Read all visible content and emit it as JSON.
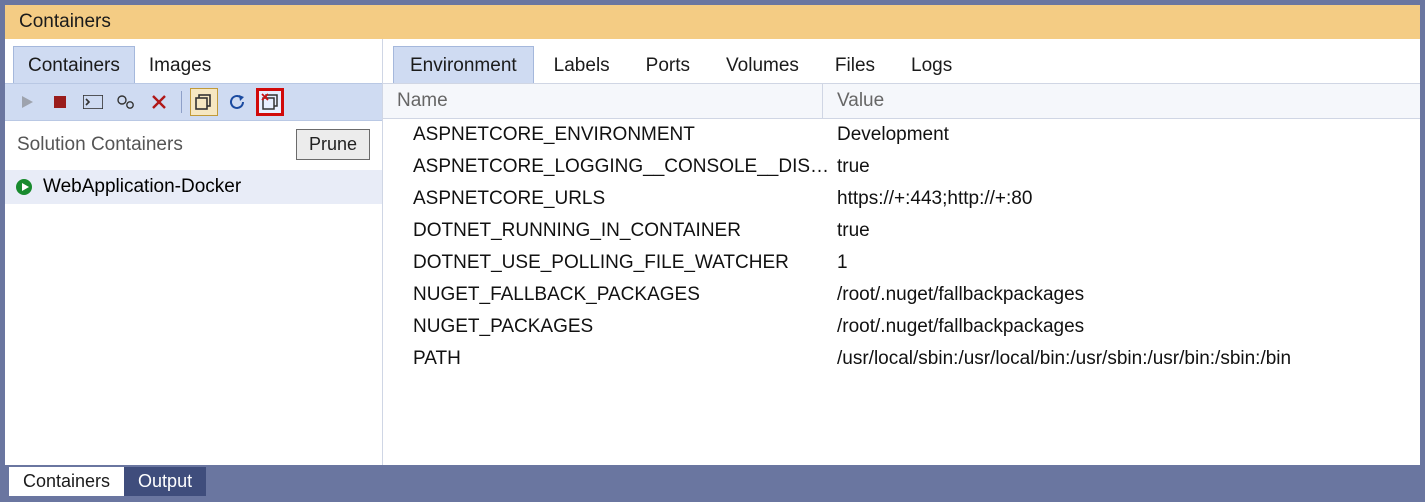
{
  "title": "Containers",
  "leftTabs": {
    "containers": "Containers",
    "images": "Images"
  },
  "sectionHeader": "Solution Containers",
  "pruneLabel": "Prune",
  "containers": [
    {
      "name": "WebApplication-Docker"
    }
  ],
  "detailTabs": {
    "environment": "Environment",
    "labels": "Labels",
    "ports": "Ports",
    "volumes": "Volumes",
    "files": "Files",
    "logs": "Logs"
  },
  "grid": {
    "cols": {
      "name": "Name",
      "value": "Value"
    },
    "rows": [
      {
        "name": "ASPNETCORE_ENVIRONMENT",
        "value": "Development"
      },
      {
        "name": "ASPNETCORE_LOGGING__CONSOLE__DISA...",
        "value": "true"
      },
      {
        "name": "ASPNETCORE_URLS",
        "value": "https://+:443;http://+:80"
      },
      {
        "name": "DOTNET_RUNNING_IN_CONTAINER",
        "value": "true"
      },
      {
        "name": "DOTNET_USE_POLLING_FILE_WATCHER",
        "value": "1"
      },
      {
        "name": "NUGET_FALLBACK_PACKAGES",
        "value": "/root/.nuget/fallbackpackages"
      },
      {
        "name": "NUGET_PACKAGES",
        "value": "/root/.nuget/fallbackpackages"
      },
      {
        "name": "PATH",
        "value": "/usr/local/sbin:/usr/local/bin:/usr/sbin:/usr/bin:/sbin:/bin"
      }
    ]
  },
  "bottomTabs": {
    "containers": "Containers",
    "output": "Output"
  }
}
